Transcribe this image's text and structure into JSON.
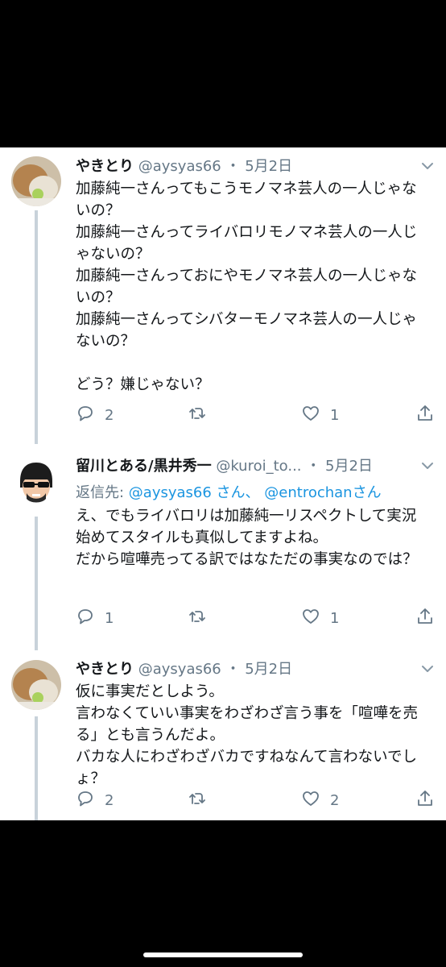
{
  "tweets": [
    {
      "name": "やきとり",
      "handle": "@aysyas66",
      "dot": "・",
      "date": "5月2日",
      "text": "加藤純一さんってもこうモノマネ芸人の一人じゃないの？\n加藤純一さんってライバロリモノマネ芸人の一人じゃないの？\n加藤純一さんっておにやモノマネ芸人の一人じゃないの？\n加藤純一さんってシバターモノマネ芸人の一人じゃないの？\n\nどう？嫌じゃない？",
      "reply_count": "2",
      "retweet_count": "",
      "like_count": "1"
    },
    {
      "name": "留川とある/黒井秀一",
      "handle": "@kuroi_to...",
      "dot": "・",
      "date": "5月2日",
      "replying_label": "返信先: ",
      "replying_to_1": "@aysyas66 さん、",
      "replying_to_2": "@entrochan",
      "replying_suffix": "さん",
      "text": "え、でもライバロリは加藤純一リスペクトして実況始めてスタイルも真似してますよね。\nだから喧嘩売ってる訳ではなただの事実なのでは？",
      "reply_count": "1",
      "retweet_count": "",
      "like_count": "1"
    },
    {
      "name": "やきとり",
      "handle": "@aysyas66",
      "dot": "・",
      "date": "5月2日",
      "text": "仮に事実だとしよう。\n言わなくていい事実をわざわざ言う事を「喧嘩を売る」とも言うんだよ。\nバカな人にわざわざバカですねなんて言わないでしょ？",
      "reply_count": "2",
      "retweet_count": "",
      "like_count": "2"
    }
  ],
  "icons": {
    "reply": "reply-icon",
    "retweet": "retweet-icon",
    "like": "heart-icon",
    "share": "share-icon",
    "caret": "chevron-down-icon"
  },
  "colors": {
    "text": "#14171a",
    "secondary": "#657786",
    "link": "#1b95e0",
    "thread_line": "#c8d2da"
  }
}
